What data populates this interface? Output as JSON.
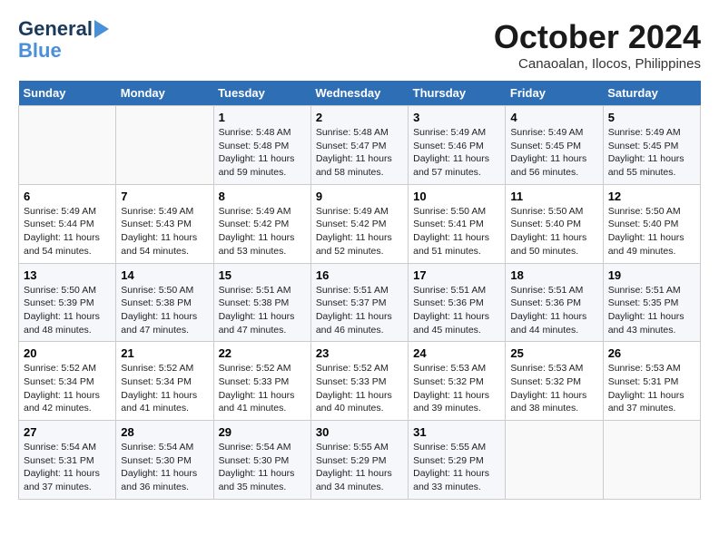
{
  "header": {
    "logo_line1": "General",
    "logo_line2": "Blue",
    "month": "October 2024",
    "location": "Canaoalan, Ilocos, Philippines"
  },
  "days_of_week": [
    "Sunday",
    "Monday",
    "Tuesday",
    "Wednesday",
    "Thursday",
    "Friday",
    "Saturday"
  ],
  "weeks": [
    [
      {
        "day": "",
        "info": ""
      },
      {
        "day": "",
        "info": ""
      },
      {
        "day": "1",
        "info": "Sunrise: 5:48 AM\nSunset: 5:48 PM\nDaylight: 11 hours and 59 minutes."
      },
      {
        "day": "2",
        "info": "Sunrise: 5:48 AM\nSunset: 5:47 PM\nDaylight: 11 hours and 58 minutes."
      },
      {
        "day": "3",
        "info": "Sunrise: 5:49 AM\nSunset: 5:46 PM\nDaylight: 11 hours and 57 minutes."
      },
      {
        "day": "4",
        "info": "Sunrise: 5:49 AM\nSunset: 5:45 PM\nDaylight: 11 hours and 56 minutes."
      },
      {
        "day": "5",
        "info": "Sunrise: 5:49 AM\nSunset: 5:45 PM\nDaylight: 11 hours and 55 minutes."
      }
    ],
    [
      {
        "day": "6",
        "info": "Sunrise: 5:49 AM\nSunset: 5:44 PM\nDaylight: 11 hours and 54 minutes."
      },
      {
        "day": "7",
        "info": "Sunrise: 5:49 AM\nSunset: 5:43 PM\nDaylight: 11 hours and 54 minutes."
      },
      {
        "day": "8",
        "info": "Sunrise: 5:49 AM\nSunset: 5:42 PM\nDaylight: 11 hours and 53 minutes."
      },
      {
        "day": "9",
        "info": "Sunrise: 5:49 AM\nSunset: 5:42 PM\nDaylight: 11 hours and 52 minutes."
      },
      {
        "day": "10",
        "info": "Sunrise: 5:50 AM\nSunset: 5:41 PM\nDaylight: 11 hours and 51 minutes."
      },
      {
        "day": "11",
        "info": "Sunrise: 5:50 AM\nSunset: 5:40 PM\nDaylight: 11 hours and 50 minutes."
      },
      {
        "day": "12",
        "info": "Sunrise: 5:50 AM\nSunset: 5:40 PM\nDaylight: 11 hours and 49 minutes."
      }
    ],
    [
      {
        "day": "13",
        "info": "Sunrise: 5:50 AM\nSunset: 5:39 PM\nDaylight: 11 hours and 48 minutes."
      },
      {
        "day": "14",
        "info": "Sunrise: 5:50 AM\nSunset: 5:38 PM\nDaylight: 11 hours and 47 minutes."
      },
      {
        "day": "15",
        "info": "Sunrise: 5:51 AM\nSunset: 5:38 PM\nDaylight: 11 hours and 47 minutes."
      },
      {
        "day": "16",
        "info": "Sunrise: 5:51 AM\nSunset: 5:37 PM\nDaylight: 11 hours and 46 minutes."
      },
      {
        "day": "17",
        "info": "Sunrise: 5:51 AM\nSunset: 5:36 PM\nDaylight: 11 hours and 45 minutes."
      },
      {
        "day": "18",
        "info": "Sunrise: 5:51 AM\nSunset: 5:36 PM\nDaylight: 11 hours and 44 minutes."
      },
      {
        "day": "19",
        "info": "Sunrise: 5:51 AM\nSunset: 5:35 PM\nDaylight: 11 hours and 43 minutes."
      }
    ],
    [
      {
        "day": "20",
        "info": "Sunrise: 5:52 AM\nSunset: 5:34 PM\nDaylight: 11 hours and 42 minutes."
      },
      {
        "day": "21",
        "info": "Sunrise: 5:52 AM\nSunset: 5:34 PM\nDaylight: 11 hours and 41 minutes."
      },
      {
        "day": "22",
        "info": "Sunrise: 5:52 AM\nSunset: 5:33 PM\nDaylight: 11 hours and 41 minutes."
      },
      {
        "day": "23",
        "info": "Sunrise: 5:52 AM\nSunset: 5:33 PM\nDaylight: 11 hours and 40 minutes."
      },
      {
        "day": "24",
        "info": "Sunrise: 5:53 AM\nSunset: 5:32 PM\nDaylight: 11 hours and 39 minutes."
      },
      {
        "day": "25",
        "info": "Sunrise: 5:53 AM\nSunset: 5:32 PM\nDaylight: 11 hours and 38 minutes."
      },
      {
        "day": "26",
        "info": "Sunrise: 5:53 AM\nSunset: 5:31 PM\nDaylight: 11 hours and 37 minutes."
      }
    ],
    [
      {
        "day": "27",
        "info": "Sunrise: 5:54 AM\nSunset: 5:31 PM\nDaylight: 11 hours and 37 minutes."
      },
      {
        "day": "28",
        "info": "Sunrise: 5:54 AM\nSunset: 5:30 PM\nDaylight: 11 hours and 36 minutes."
      },
      {
        "day": "29",
        "info": "Sunrise: 5:54 AM\nSunset: 5:30 PM\nDaylight: 11 hours and 35 minutes."
      },
      {
        "day": "30",
        "info": "Sunrise: 5:55 AM\nSunset: 5:29 PM\nDaylight: 11 hours and 34 minutes."
      },
      {
        "day": "31",
        "info": "Sunrise: 5:55 AM\nSunset: 5:29 PM\nDaylight: 11 hours and 33 minutes."
      },
      {
        "day": "",
        "info": ""
      },
      {
        "day": "",
        "info": ""
      }
    ]
  ]
}
